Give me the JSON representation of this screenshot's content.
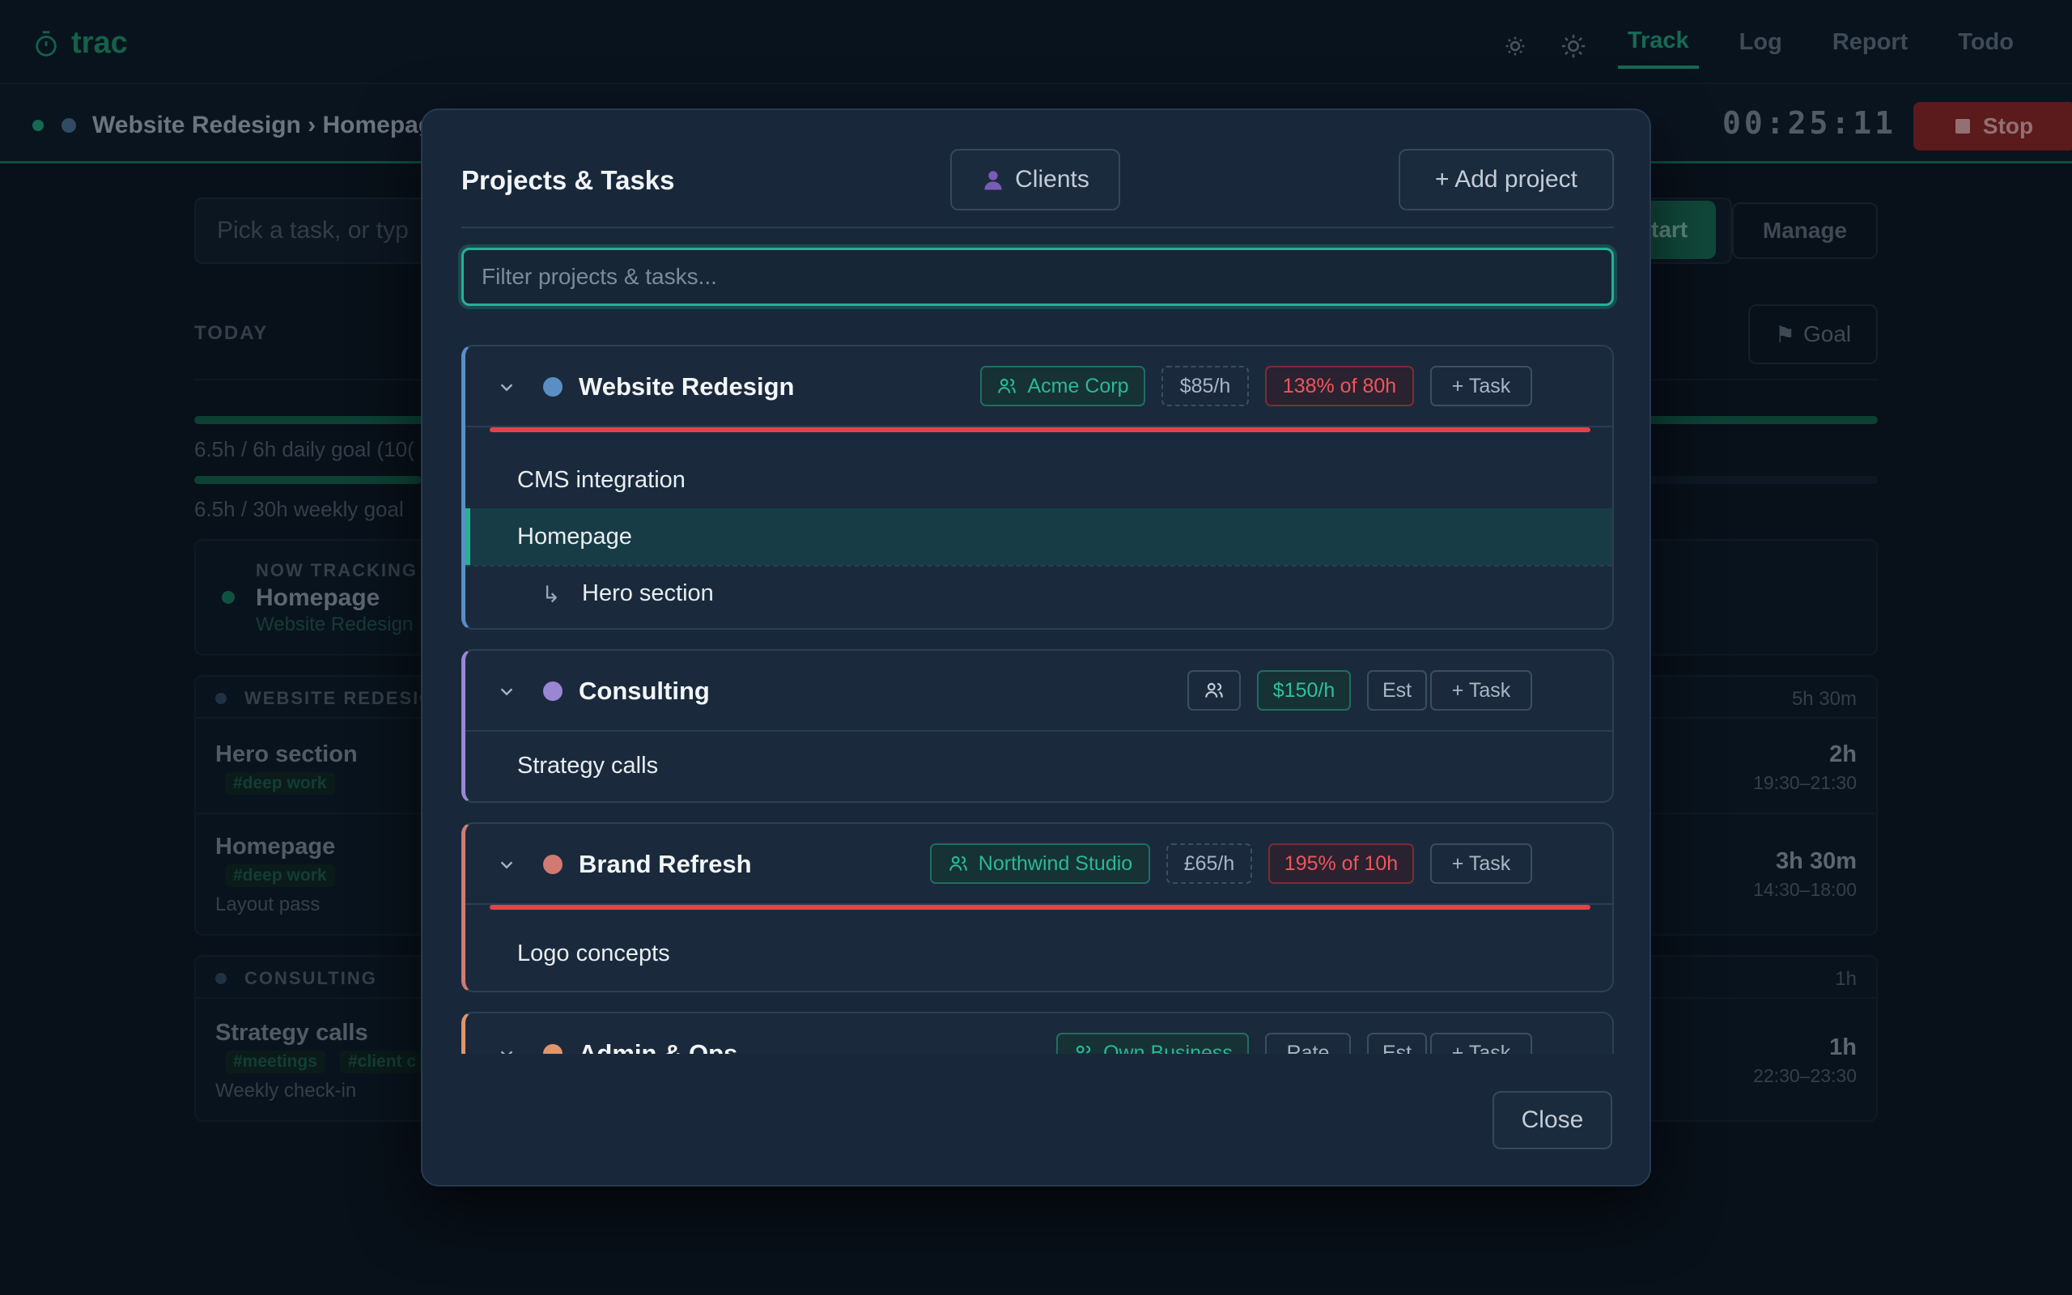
{
  "app": {
    "brand": "trac",
    "nav": {
      "tabs": [
        "Track",
        "Log",
        "Report",
        "Todo"
      ],
      "active": "Track"
    }
  },
  "tracking_bar": {
    "breadcrumb": "Website Redesign › Homepage",
    "timer": "00:25:11",
    "stop_label": "Stop"
  },
  "main": {
    "task_input_placeholder": "Pick a task, or typ",
    "start_label": "tart",
    "manage_label": "Manage",
    "today_label": "TODAY",
    "goal_label": "Goal",
    "daily_goal": "6.5h / 6h daily goal (10(",
    "daily_goal_progress": 1.0,
    "weekly_goal": "6.5h / 30h weekly goal",
    "weekly_goal_progress": 0.22,
    "now_tracking": {
      "label": "NOW TRACKING",
      "task": "Homepage",
      "project": "Website Redesign"
    },
    "groups": [
      {
        "name": "WEBSITE REDESIGN",
        "total": "5h 30m",
        "entries": [
          {
            "task": "Hero section",
            "tags": [
              "#deep work"
            ],
            "note": "",
            "duration": "2h",
            "range": "19:30–21:30"
          },
          {
            "task": "Homepage",
            "tags": [
              "#deep work"
            ],
            "note": "Layout pass",
            "duration": "3h 30m",
            "range": "14:30–18:00"
          }
        ]
      },
      {
        "name": "CONSULTING",
        "total": "1h",
        "entries": [
          {
            "task": "Strategy calls",
            "tags": [
              "#meetings",
              "#client c"
            ],
            "note": "Weekly check-in",
            "duration": "1h",
            "range": "22:30–23:30"
          }
        ]
      }
    ]
  },
  "modal": {
    "title": "Projects & Tasks",
    "clients_button": "Clients",
    "add_project_button": "+ Add project",
    "filter_placeholder": "Filter projects & tasks...",
    "close_button": "Close",
    "projects": [
      {
        "name": "Website Redesign",
        "color": "#5b8ec4",
        "client": "Acme Corp",
        "rate": "$85/h",
        "budget": "138% of 80h",
        "add_task": "+ Task",
        "tasks": [
          {
            "name": "CMS integration"
          },
          {
            "name": "Homepage",
            "active": true
          },
          {
            "name": "Hero section",
            "subtask": true
          }
        ]
      },
      {
        "name": "Consulting",
        "color": "#9b86d4",
        "client": "",
        "rate": "$150/h",
        "budget": "Est",
        "add_task": "+ Task",
        "tasks": [
          {
            "name": "Strategy calls"
          }
        ]
      },
      {
        "name": "Brand Refresh",
        "color": "#d07a74",
        "client": "Northwind Studio",
        "rate": "£65/h",
        "budget": "195% of 10h",
        "add_task": "+ Task",
        "tasks": [
          {
            "name": "Logo concepts"
          }
        ]
      },
      {
        "name": "Admin & Ops",
        "color": "#e0956b",
        "client": "Own Business",
        "rate": "Rate",
        "budget": "Est",
        "add_task": "+ Task",
        "tasks": []
      }
    ]
  }
}
